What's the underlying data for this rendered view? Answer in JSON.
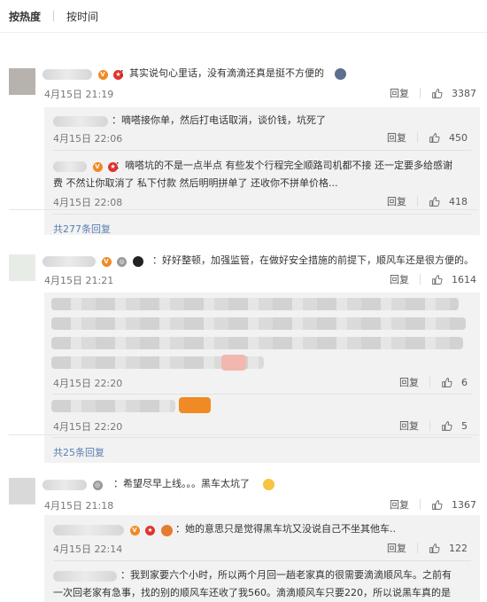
{
  "tabs": {
    "hot": "按热度",
    "time": "按时间"
  },
  "actions": {
    "reply": "回复"
  },
  "comments": [
    {
      "text": "：其实说句心里话，没有滴滴还真是挺不方便的",
      "time": "4月15日 21:19",
      "likes": "3387",
      "replies": [
        {
          "text": "：嘀嗒接你单，然后打电话取消，谈价钱，坑死了",
          "time": "4月15日 22:06",
          "likes": "450"
        },
        {
          "line1": "：嘀嗒坑的不是一点半点 有些发个行程完全顺路司机都不接 还一定要多给感谢",
          "line2": "费 不然让你取消了 私下付款 然后明明拼单了 还收你不拼单价格...",
          "time": "4月15日 22:08",
          "likes": "418"
        }
      ],
      "more": "共277条回复"
    },
    {
      "text": "：好好整顿，加强监管，在做好安全措施的前提下，顺风车还是很方便的。",
      "time": "4月15日 21:21",
      "likes": "1614",
      "replies": [
        {
          "time": "4月15日 22:20",
          "likes": "6"
        },
        {
          "time": "4月15日 22:20",
          "likes": "5"
        }
      ],
      "more": "共25条回复"
    },
    {
      "text": "：希望尽早上线。。。黑车太坑了",
      "time": "4月15日 21:18",
      "likes": "1367",
      "replies": [
        {
          "text": "：她的意思只是觉得黑车坑又没说自己不坐其他车..",
          "time": "4月15日 22:14",
          "likes": "122"
        },
        {
          "line1": "：我到家要六个小时，所以两个月回一趟老家真的很需要滴滴顺风车。之前有",
          "line2": "一次回老家有急事，找的别的顺风车还收了我560。滴滴顺风车只要220，所以说黑车真的是"
        }
      ]
    }
  ]
}
